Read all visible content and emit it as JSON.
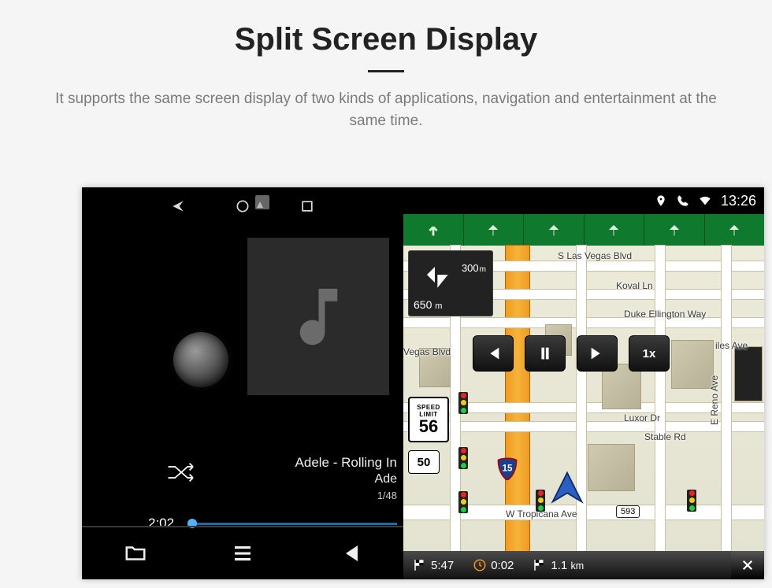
{
  "page": {
    "title": "Split Screen Display",
    "subtitle": "It supports the same screen display of two kinds of applications, navigation and entertainment at the same time."
  },
  "statusbar": {
    "time": "13:26"
  },
  "player": {
    "track_title": "Adele - Rolling In",
    "artist": "Ade",
    "index": "1/48",
    "elapsed": "2:02"
  },
  "navigation": {
    "turn": {
      "distance_next": "300",
      "distance_next_unit": "m",
      "distance_total": "650",
      "distance_total_unit": "m"
    },
    "speed_limit": {
      "label": "SPEED LIMIT",
      "value": "56"
    },
    "route_shield": "50",
    "interstate": "15",
    "playback_speed": "1x",
    "streets": {
      "s_las_vegas": "S Las Vegas Blvd",
      "koval": "Koval Ln",
      "duke": "Duke Ellington Way",
      "vegas_blvd": "Vegas Blvd",
      "luxor": "Luxor Dr",
      "stable": "Stable Rd",
      "reno": "E Reno Ave",
      "tropicana": "W Tropicana Ave",
      "tropicana_num": "593",
      "giles": "iles Ave"
    },
    "footer": {
      "eta": "5:47",
      "delay": "0:02",
      "remaining_dist": "1.1",
      "remaining_unit": "km"
    }
  }
}
